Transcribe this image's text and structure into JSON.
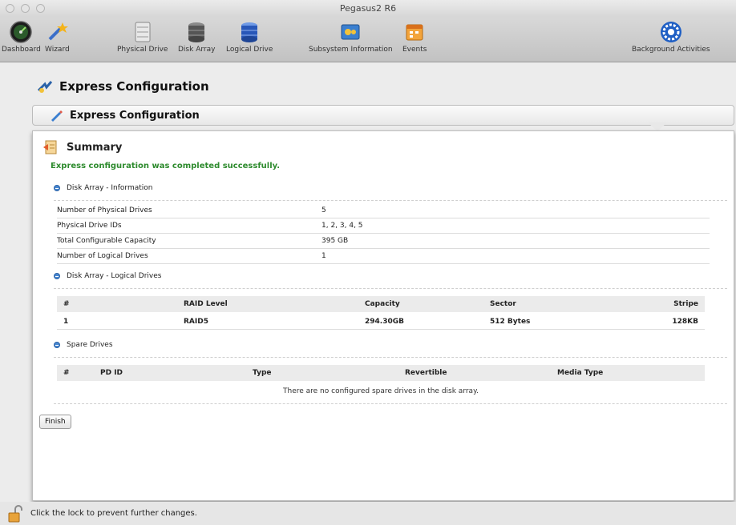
{
  "window": {
    "title": "Pegasus2 R6"
  },
  "toolbar": {
    "items": [
      {
        "label": "Dashboard",
        "icon": "dashboard-gauge-icon"
      },
      {
        "label": "Wizard",
        "icon": "wizard-icon"
      },
      {
        "label": "Physical Drive",
        "icon": "physical-drive-icon"
      },
      {
        "label": "Disk Array",
        "icon": "disk-array-icon"
      },
      {
        "label": "Logical Drive",
        "icon": "logical-drive-icon"
      },
      {
        "label": "Subsystem Information",
        "icon": "subsystem-info-icon"
      },
      {
        "label": "Events",
        "icon": "events-calendar-icon"
      },
      {
        "label": "Background Activities",
        "icon": "background-activities-icon"
      }
    ]
  },
  "page": {
    "heading": "Express Configuration"
  },
  "tab": {
    "title": "Express Configuration"
  },
  "summary": {
    "title": "Summary",
    "success_message": "Express configuration was completed successfully."
  },
  "disk_array_info": {
    "title": "Disk Array - Information",
    "rows": [
      {
        "key": "Number of Physical Drives",
        "value": "5"
      },
      {
        "key": "Physical Drive IDs",
        "value": "1, 2, 3, 4, 5"
      },
      {
        "key": "Total Configurable Capacity",
        "value": "395 GB"
      },
      {
        "key": "Number of Logical Drives",
        "value": "1"
      }
    ]
  },
  "logical_drives": {
    "title": "Disk Array - Logical Drives",
    "columns": [
      "#",
      "RAID Level",
      "Capacity",
      "Sector",
      "Stripe"
    ],
    "rows": [
      [
        "1",
        "RAID5",
        "294.30GB",
        "512 Bytes",
        "128KB"
      ]
    ]
  },
  "spare_drives": {
    "title": "Spare Drives",
    "columns": [
      "#",
      "PD ID",
      "Type",
      "Revertible",
      "Media Type"
    ],
    "empty_message": "There are no configured spare drives in the disk array."
  },
  "buttons": {
    "finish": "Finish"
  },
  "status": {
    "lock_message": "Click the lock to prevent further changes."
  },
  "colors": {
    "success": "#2e8b2e",
    "accent": "#2a62a8"
  }
}
